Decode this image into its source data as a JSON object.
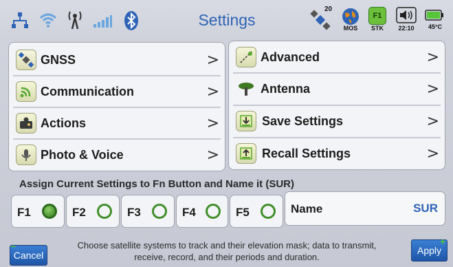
{
  "header": {
    "title": "Settings",
    "satellite_count": "20",
    "mos_label": "MOS",
    "stk_label": "STK",
    "stk_badge": "F1",
    "time": "22:10",
    "temperature": "45°C",
    "accent_color": "#2f63b6"
  },
  "left_menu": [
    {
      "label": "GNSS",
      "icon": "satellite-icon"
    },
    {
      "label": "Communication",
      "icon": "signal-icon"
    },
    {
      "label": "Actions",
      "icon": "actions-icon"
    },
    {
      "label": "Photo & Voice",
      "icon": "microphone-icon"
    }
  ],
  "right_menu": [
    {
      "label": "Advanced",
      "icon": "advanced-icon"
    },
    {
      "label": "Antenna",
      "icon": "antenna-icon"
    },
    {
      "label": "Save Settings",
      "icon": "save-icon"
    },
    {
      "label": "Recall Settings",
      "icon": "recall-icon"
    }
  ],
  "chevron": ">",
  "assign": {
    "label": "Assign Current Settings to Fn Button and Name it (SUR)",
    "buttons": [
      {
        "label": "F1",
        "selected": true
      },
      {
        "label": "F2",
        "selected": false
      },
      {
        "label": "F3",
        "selected": false
      },
      {
        "label": "F4",
        "selected": false
      },
      {
        "label": "F5",
        "selected": false
      }
    ],
    "name_label": "Name",
    "name_value": "SUR"
  },
  "footer": {
    "help_text": "Choose satellite systems to track and their elevation mask; data to transmit, receive, record,  and their periods and duration.",
    "cancel_label": "Cancel",
    "apply_label": "Apply"
  }
}
